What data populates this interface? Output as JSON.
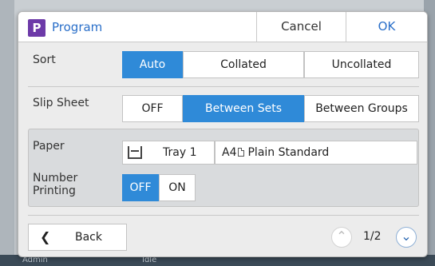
{
  "dialog": {
    "title": "Program",
    "app_icon_letter": "P",
    "cancel_label": "Cancel",
    "ok_label": "OK"
  },
  "sort": {
    "label": "Sort",
    "options": [
      "Auto",
      "Collated",
      "Uncollated"
    ],
    "selected": "Auto"
  },
  "slip_sheet": {
    "label": "Slip Sheet",
    "options": [
      "OFF",
      "Between Sets",
      "Between Groups"
    ],
    "selected": "Between Sets"
  },
  "paper": {
    "label": "Paper",
    "tray_label": "Tray 1",
    "size": "A4",
    "type": "Plain Standard"
  },
  "number_printing": {
    "label_line1": "Number",
    "label_line2": "Printing",
    "options": [
      "OFF",
      "ON"
    ],
    "selected": "OFF"
  },
  "footer": {
    "back_label": "Back",
    "page_indicator": "1/2"
  },
  "background": {
    "status_left": "Admin",
    "status_mid": "Idle"
  },
  "colors": {
    "accent": "#2f8ad8",
    "title_blue": "#2a6fc9",
    "app_icon": "#6d3aa8"
  },
  "icons": {
    "app": "program-icon",
    "tray": "paper-tray-icon",
    "orientation": "portrait-orientation-icon",
    "back": "chevron-left-icon",
    "page_up": "chevron-up-icon",
    "page_down": "chevron-down-icon"
  }
}
